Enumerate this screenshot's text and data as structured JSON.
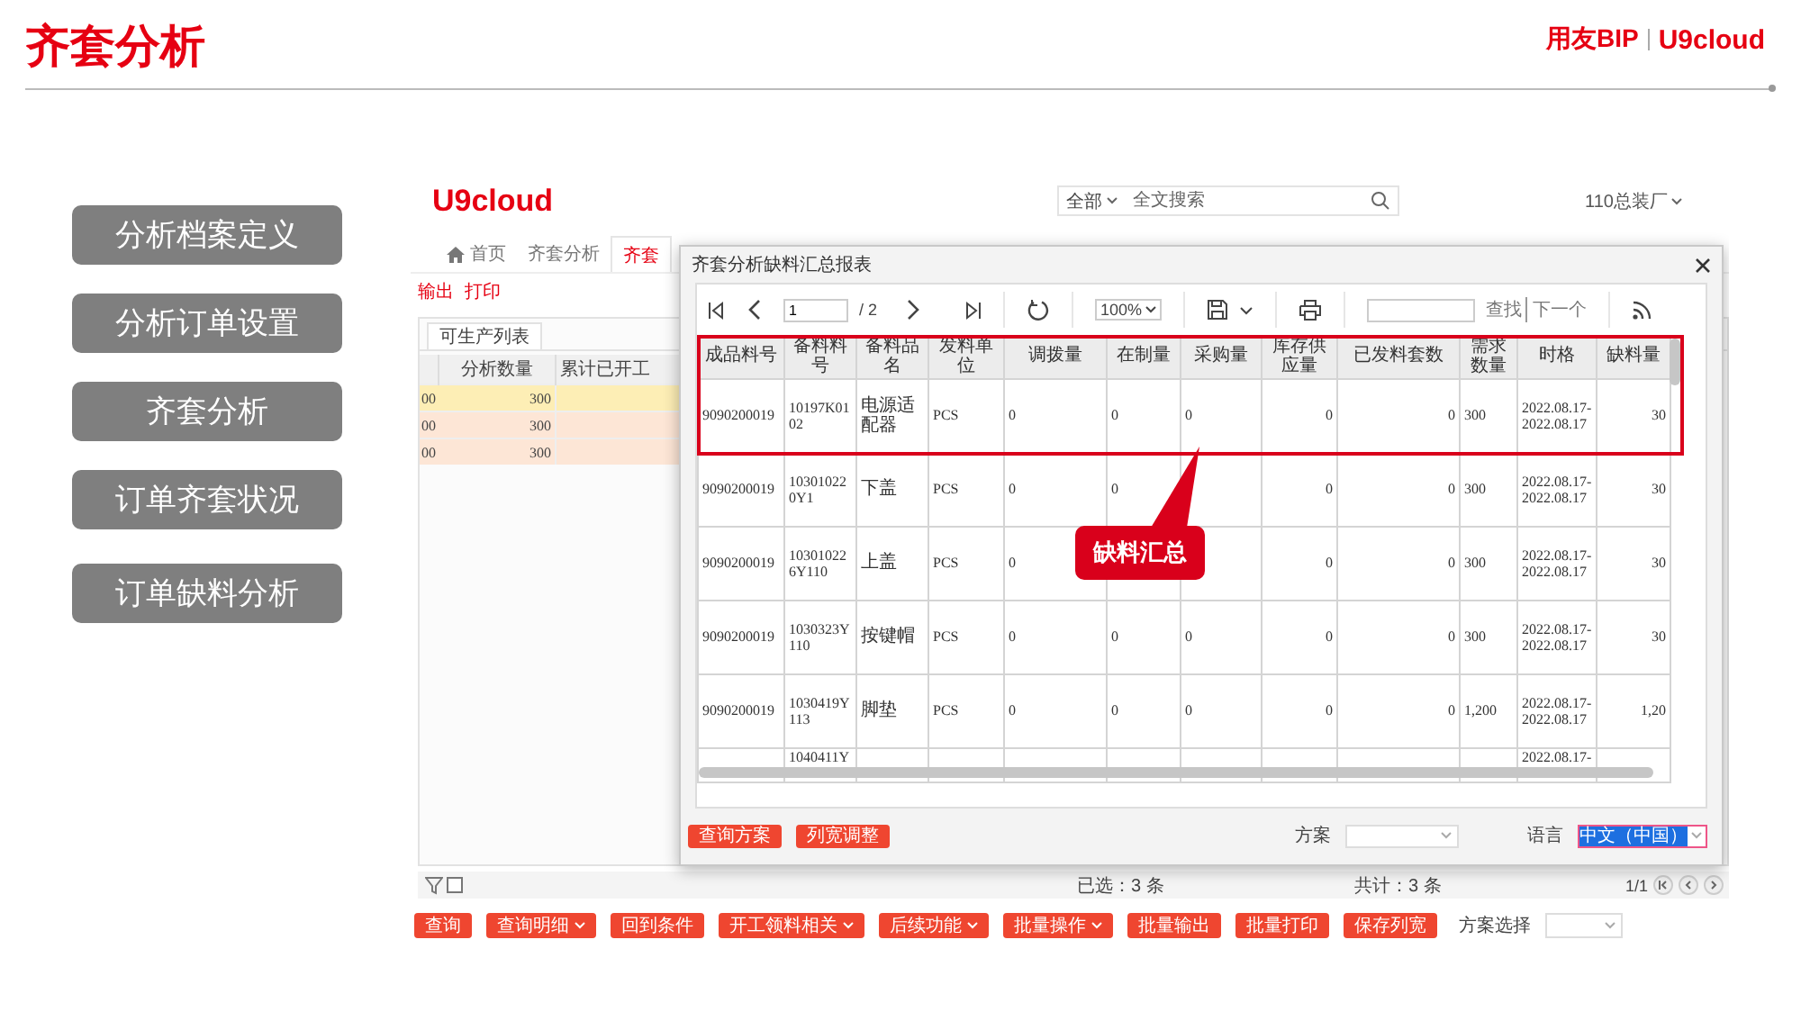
{
  "slide": {
    "title": "齐套分析",
    "brand": {
      "primary": "用友BIP",
      "secondary": "U9cloud"
    }
  },
  "menu": [
    {
      "label": "分析档案定义"
    },
    {
      "label": "分析订单设置"
    },
    {
      "label": "齐套分析"
    },
    {
      "label": "订单齐套状况"
    },
    {
      "label": "订单缺料分析"
    }
  ],
  "app": {
    "logo": "U9cloud",
    "search": {
      "scope": "全部",
      "placeholder": "全文搜索"
    },
    "organization": "110总装厂",
    "tabs": [
      {
        "label": "首页",
        "selected": false,
        "kind": "home"
      },
      {
        "label": "齐套分析",
        "selected": false,
        "kind": "page"
      },
      {
        "label": "齐套",
        "selected": true,
        "kind": "page"
      }
    ],
    "actions": [
      "输出",
      "打印"
    ],
    "list_tab": "可生产列表",
    "grid": {
      "columns": [
        "分析数量",
        "累计已开工"
      ],
      "rows": [
        {
          "column_1": "00",
          "quantity": "300",
          "selected": true,
          "focused": true
        },
        {
          "column_1": "00",
          "quantity": "300",
          "selected": true,
          "focused": false
        },
        {
          "column_1": "00",
          "quantity": "300",
          "selected": true,
          "focused": false
        }
      ]
    },
    "status": {
      "filter_checked": false,
      "selected_text": "已选：3 条",
      "total_text": "共计：3 条",
      "page": "1/1"
    },
    "buttons": [
      {
        "label": "查询",
        "dropdown": false
      },
      {
        "label": "查询明细",
        "dropdown": true
      },
      {
        "label": "回到条件",
        "dropdown": false
      },
      {
        "label": "开工领料相关",
        "dropdown": true
      },
      {
        "label": "后续功能",
        "dropdown": true
      },
      {
        "label": "批量操作",
        "dropdown": true
      },
      {
        "label": "批量输出",
        "dropdown": false
      },
      {
        "label": "批量打印",
        "dropdown": false
      },
      {
        "label": "保存列宽",
        "dropdown": false
      }
    ],
    "scheme_label": "方案选择"
  },
  "dialog": {
    "title": "齐套分析缺料汇总报表",
    "toolbar": {
      "page": "1",
      "pages": "/ 2",
      "zoom": "100%",
      "find": "查找",
      "next": "下一个"
    },
    "table": {
      "columns": [
        "成品料号",
        "备料料号",
        "备料品名",
        "发料单位",
        "调拨量",
        "在制量",
        "采购量",
        "库存供应量",
        "已发料套数",
        "需求数量",
        "时格",
        "缺料量"
      ],
      "rows": [
        {
          "cells": [
            "9090200019",
            "10197K0102",
            "电源适配器",
            "PCS",
            "0",
            "0",
            "0",
            "0",
            "0",
            "300",
            "2022.08.17-2022.08.17",
            "30"
          ]
        },
        {
          "cells": [
            "9090200019",
            "103010220Y1",
            "下盖",
            "PCS",
            "0",
            "0",
            null,
            "0",
            "0",
            "300",
            "2022.08.17-2022.08.17",
            "30"
          ]
        },
        {
          "cells": [
            "9090200019",
            "103010226Y110",
            "上盖",
            "PCS",
            "0",
            null,
            null,
            "0",
            "0",
            "300",
            "2022.08.17-2022.08.17",
            "30"
          ]
        },
        {
          "cells": [
            "9090200019",
            "1030323Y110",
            "按键帽",
            "PCS",
            "0",
            "0",
            "0",
            "0",
            "0",
            "300",
            "2022.08.17-2022.08.17",
            "30"
          ]
        },
        {
          "cells": [
            "9090200019",
            "1030419Y113",
            "脚垫",
            "PCS",
            "0",
            "0",
            "0",
            "0",
            "0",
            "1,200",
            "2022.08.17-2022.08.17",
            "1,20"
          ]
        },
        {
          "cells": [
            null,
            "1040411Y",
            null,
            null,
            null,
            null,
            null,
            null,
            null,
            null,
            "2022.08.17-",
            null
          ]
        }
      ]
    },
    "footer": {
      "buttons": [
        "查询方案",
        "列宽调整"
      ],
      "scheme_label": "方案",
      "language_label": "语言",
      "language": "中文（中国）"
    }
  },
  "callout": {
    "text": "缺料汇总"
  }
}
